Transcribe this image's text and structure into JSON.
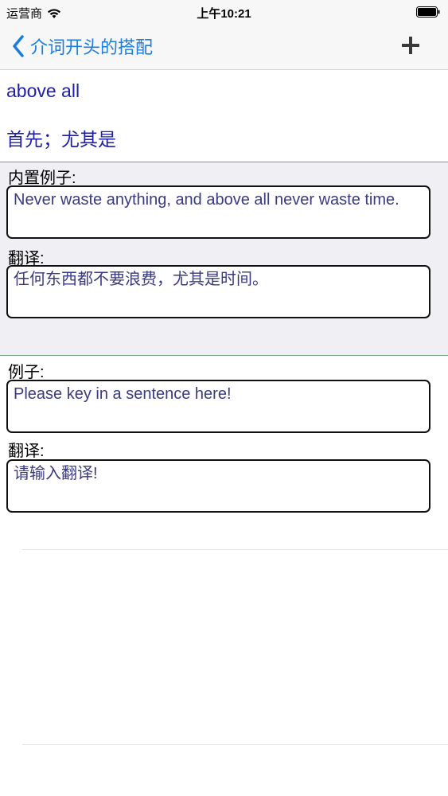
{
  "status_bar": {
    "carrier": "运营商",
    "time": "上午10:21"
  },
  "nav": {
    "back_label": "介词开头的搭配",
    "add_icon": "plus-icon",
    "accent_color": "#1a7ee0"
  },
  "entry": {
    "phrase": "above all",
    "meaning": "首先；尤其是"
  },
  "builtin": {
    "example_label": "内置例子:",
    "example_text": "Never waste anything, and above all never waste time.",
    "translation_label": "翻译:",
    "translation_text": "任何东西都不要浪费，尤其是时间。"
  },
  "user": {
    "example_label": "例子:",
    "example_placeholder": "Please key in a sentence here!",
    "translation_label": "翻译:",
    "translation_placeholder": "请输入翻译!"
  }
}
